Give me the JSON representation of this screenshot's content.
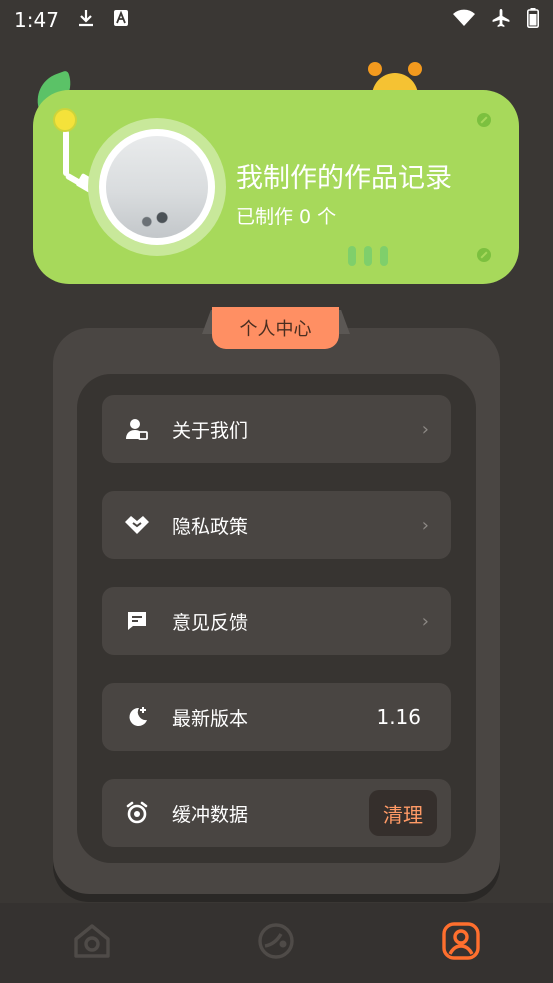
{
  "status_bar": {
    "time": "1:47"
  },
  "record_card": {
    "title": "我制作的作品记录",
    "subtitle": "已制作 0 个"
  },
  "section_badge": "个人中心",
  "menu": {
    "items": [
      {
        "label": "关于我们",
        "icon": "user-info-icon",
        "arrow": "›"
      },
      {
        "label": "隐私政策",
        "icon": "handshake-icon",
        "arrow": "›"
      },
      {
        "label": "意见反馈",
        "icon": "feedback-icon",
        "arrow": "›"
      },
      {
        "label": "最新版本",
        "icon": "moon-icon",
        "value": "1.16"
      },
      {
        "label": "缓冲数据",
        "icon": "alarm-clock-icon",
        "button": "清理"
      }
    ]
  },
  "bottom_nav": {
    "items": [
      {
        "icon": "home-icon"
      },
      {
        "icon": "discover-icon"
      },
      {
        "icon": "profile-icon"
      }
    ]
  },
  "colors": {
    "background": "#3a3734",
    "card_green": "#a7d95b",
    "accent_orange": "#ff8f63",
    "active_nav": "#ff6f2e"
  }
}
